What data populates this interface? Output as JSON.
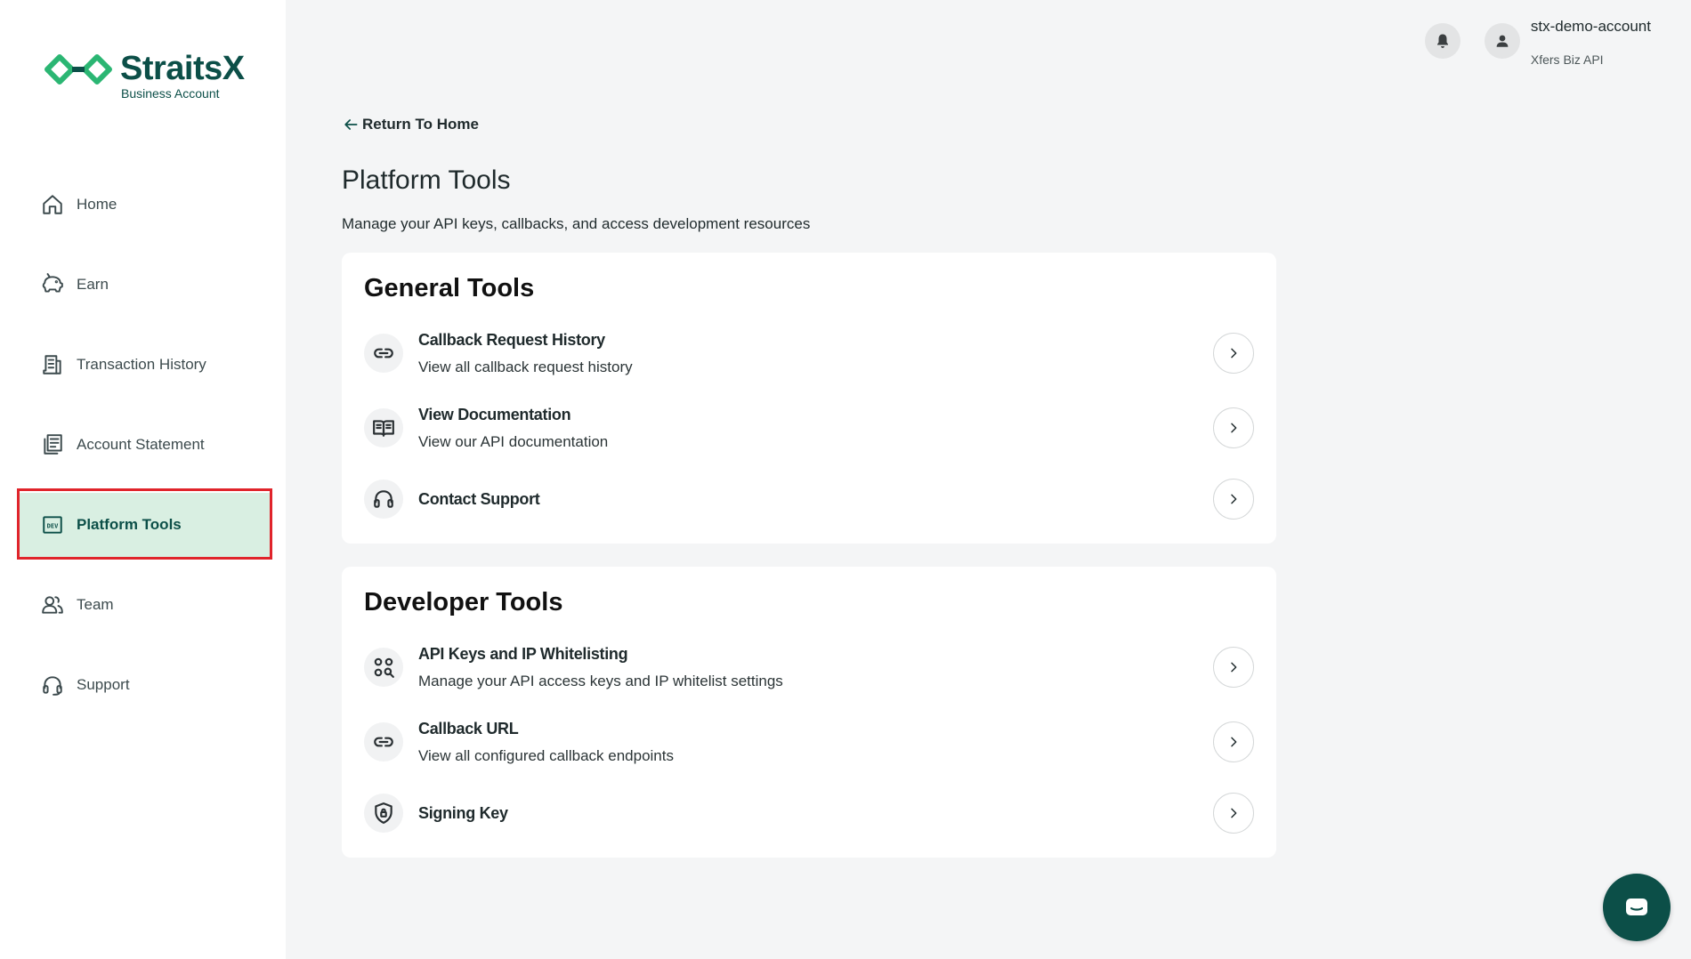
{
  "brand": {
    "name": "StraitsX",
    "subtitle": "Business Account",
    "color": "#0c4f48",
    "accent": "#2bb673"
  },
  "sidebar": {
    "items": [
      {
        "label": "Home",
        "icon": "home-icon",
        "active": false
      },
      {
        "label": "Earn",
        "icon": "piggy-bank-icon",
        "active": false
      },
      {
        "label": "Transaction History",
        "icon": "receipt-icon",
        "active": false
      },
      {
        "label": "Account Statement",
        "icon": "statement-icon",
        "active": false
      },
      {
        "label": "Platform Tools",
        "icon": "dev-icon",
        "active": true
      },
      {
        "label": "Team",
        "icon": "team-icon",
        "active": false
      },
      {
        "label": "Support",
        "icon": "headset-icon",
        "active": false
      }
    ],
    "active_bg": "#d9efe2",
    "highlight_color": "#e0242b"
  },
  "header": {
    "account_name": "stx-demo-account",
    "account_org": "Xfers Biz API"
  },
  "main": {
    "back_label": "Return To Home",
    "title": "Platform Tools",
    "subtitle": "Manage your API keys, callbacks, and access development resources",
    "sections": [
      {
        "title": "General Tools",
        "items": [
          {
            "title": "Callback Request History",
            "desc": "View all callback request history",
            "icon": "link-icon"
          },
          {
            "title": "View Documentation",
            "desc": "View our API documentation",
            "icon": "book-icon"
          },
          {
            "title": "Contact Support",
            "desc": "",
            "icon": "headset-icon"
          }
        ]
      },
      {
        "title": "Developer Tools",
        "items": [
          {
            "title": "API Keys and IP Whitelisting",
            "desc": "Manage your API access keys and IP whitelist settings",
            "icon": "key-search-icon"
          },
          {
            "title": "Callback URL",
            "desc": "View all configured callback endpoints",
            "icon": "link-icon"
          },
          {
            "title": "Signing Key",
            "desc": "",
            "icon": "shield-lock-icon"
          }
        ]
      }
    ]
  },
  "chat": {
    "icon": "chat-icon"
  }
}
